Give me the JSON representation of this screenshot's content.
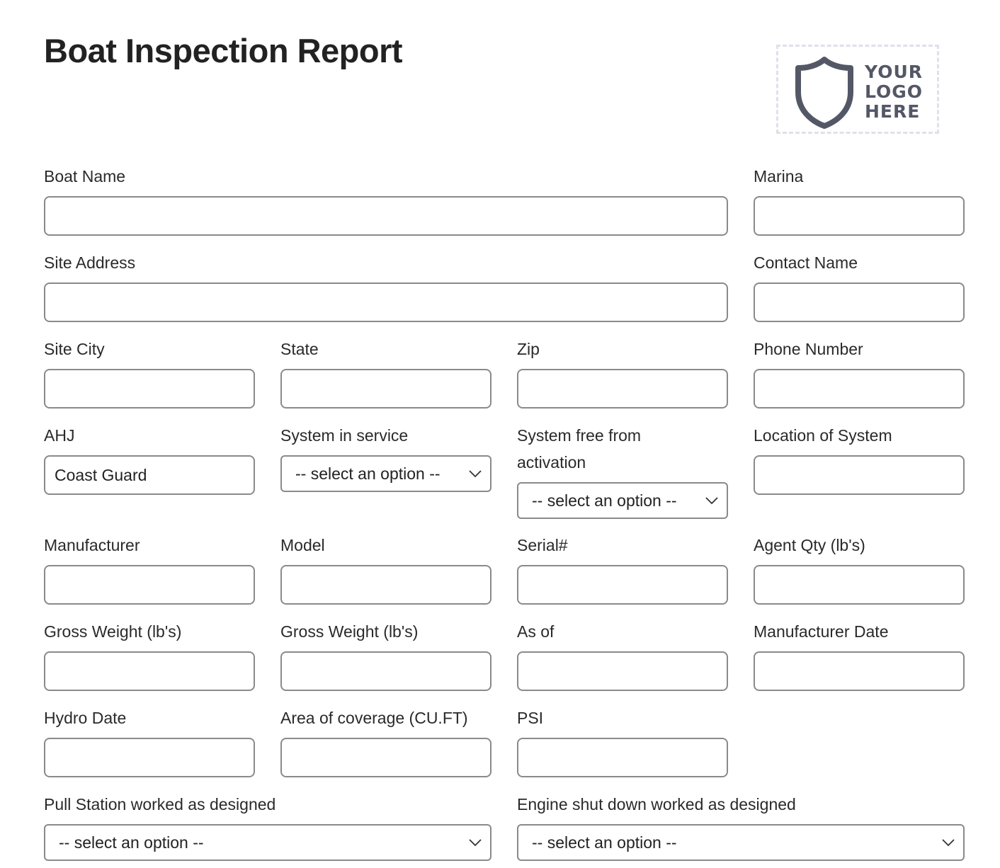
{
  "header": {
    "title": "Boat Inspection Report",
    "logo": {
      "lines": [
        "YOUR",
        "LOGO",
        "HERE"
      ],
      "icon": "shield-icon"
    }
  },
  "form": {
    "boat_name": {
      "label": "Boat Name",
      "value": ""
    },
    "marina": {
      "label": "Marina",
      "value": ""
    },
    "site_address": {
      "label": "Site Address",
      "value": ""
    },
    "contact_name": {
      "label": "Contact Name",
      "value": ""
    },
    "site_city": {
      "label": "Site City",
      "value": ""
    },
    "state": {
      "label": "State",
      "value": ""
    },
    "zip": {
      "label": "Zip",
      "value": ""
    },
    "phone_number": {
      "label": "Phone Number",
      "value": ""
    },
    "ahj": {
      "label": "AHJ",
      "value": "Coast Guard"
    },
    "system_in_service": {
      "label": "System in service",
      "selected": "-- select an option --"
    },
    "system_free_from_activation": {
      "label": "System free from activation",
      "selected": "-- select an option --"
    },
    "location_of_system": {
      "label": "Location of System",
      "value": ""
    },
    "manufacturer": {
      "label": "Manufacturer",
      "value": ""
    },
    "model": {
      "label": "Model",
      "value": ""
    },
    "serial": {
      "label": "Serial#",
      "value": ""
    },
    "agent_qty": {
      "label": "Agent Qty (lb's)",
      "value": ""
    },
    "gross_weight_1": {
      "label": "Gross Weight (lb's)",
      "value": ""
    },
    "gross_weight_2": {
      "label": "Gross Weight (lb's)",
      "value": ""
    },
    "as_of": {
      "label": "As of",
      "value": ""
    },
    "manufacturer_date": {
      "label": "Manufacturer Date",
      "value": ""
    },
    "hydro_date": {
      "label": "Hydro Date",
      "value": ""
    },
    "area_of_coverage": {
      "label": "Area of coverage (CU.FT)",
      "value": ""
    },
    "psi": {
      "label": "PSI",
      "value": ""
    },
    "pull_station": {
      "label": "Pull Station worked as designed",
      "selected": "-- select an option --"
    },
    "engine_shut_down": {
      "label": "Engine shut down worked as designed",
      "selected": "-- select an option --"
    }
  },
  "colors": {
    "title": "#222222",
    "input_border": "#8a8a8a",
    "logo_ink": "#535766",
    "logo_border": "#dfe1ea"
  }
}
